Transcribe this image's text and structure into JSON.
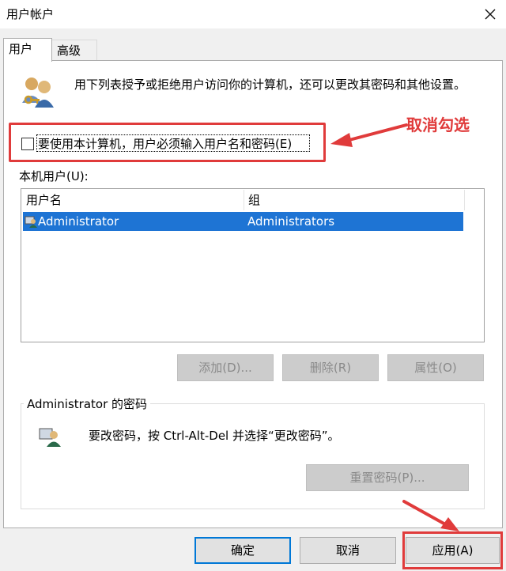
{
  "window": {
    "title": "用户帐户"
  },
  "tabs": [
    {
      "label": "用户"
    },
    {
      "label": "高级"
    }
  ],
  "description": "用下列表授予或拒绝用户访问你的计算机，还可以更改其密码和其他设置。",
  "require_password_checkbox": {
    "label": "要使用本计算机，用户必须输入用户名和密码(E)",
    "checked": false
  },
  "annotation": {
    "text": "取消勾选",
    "color": "#e03b3b"
  },
  "users_list": {
    "label": "本机用户(U):",
    "columns": [
      "用户名",
      "组"
    ],
    "rows": [
      {
        "name": "Administrator",
        "group": "Administrators",
        "selected": true
      }
    ]
  },
  "list_buttons": {
    "add": "添加(D)...",
    "remove": "删除(R)",
    "properties": "属性(O)"
  },
  "password_group": {
    "title": "Administrator 的密码",
    "text": "要改密码，按 Ctrl-Alt-Del 并选择“更改密码”。",
    "reset_button": "重置密码(P)..."
  },
  "dialog_buttons": {
    "ok": "确定",
    "cancel": "取消",
    "apply": "应用(A)"
  },
  "colors": {
    "selection": "#1e74d4",
    "annotation_red": "#e03b3b",
    "focus_blue": "#0078d7"
  }
}
